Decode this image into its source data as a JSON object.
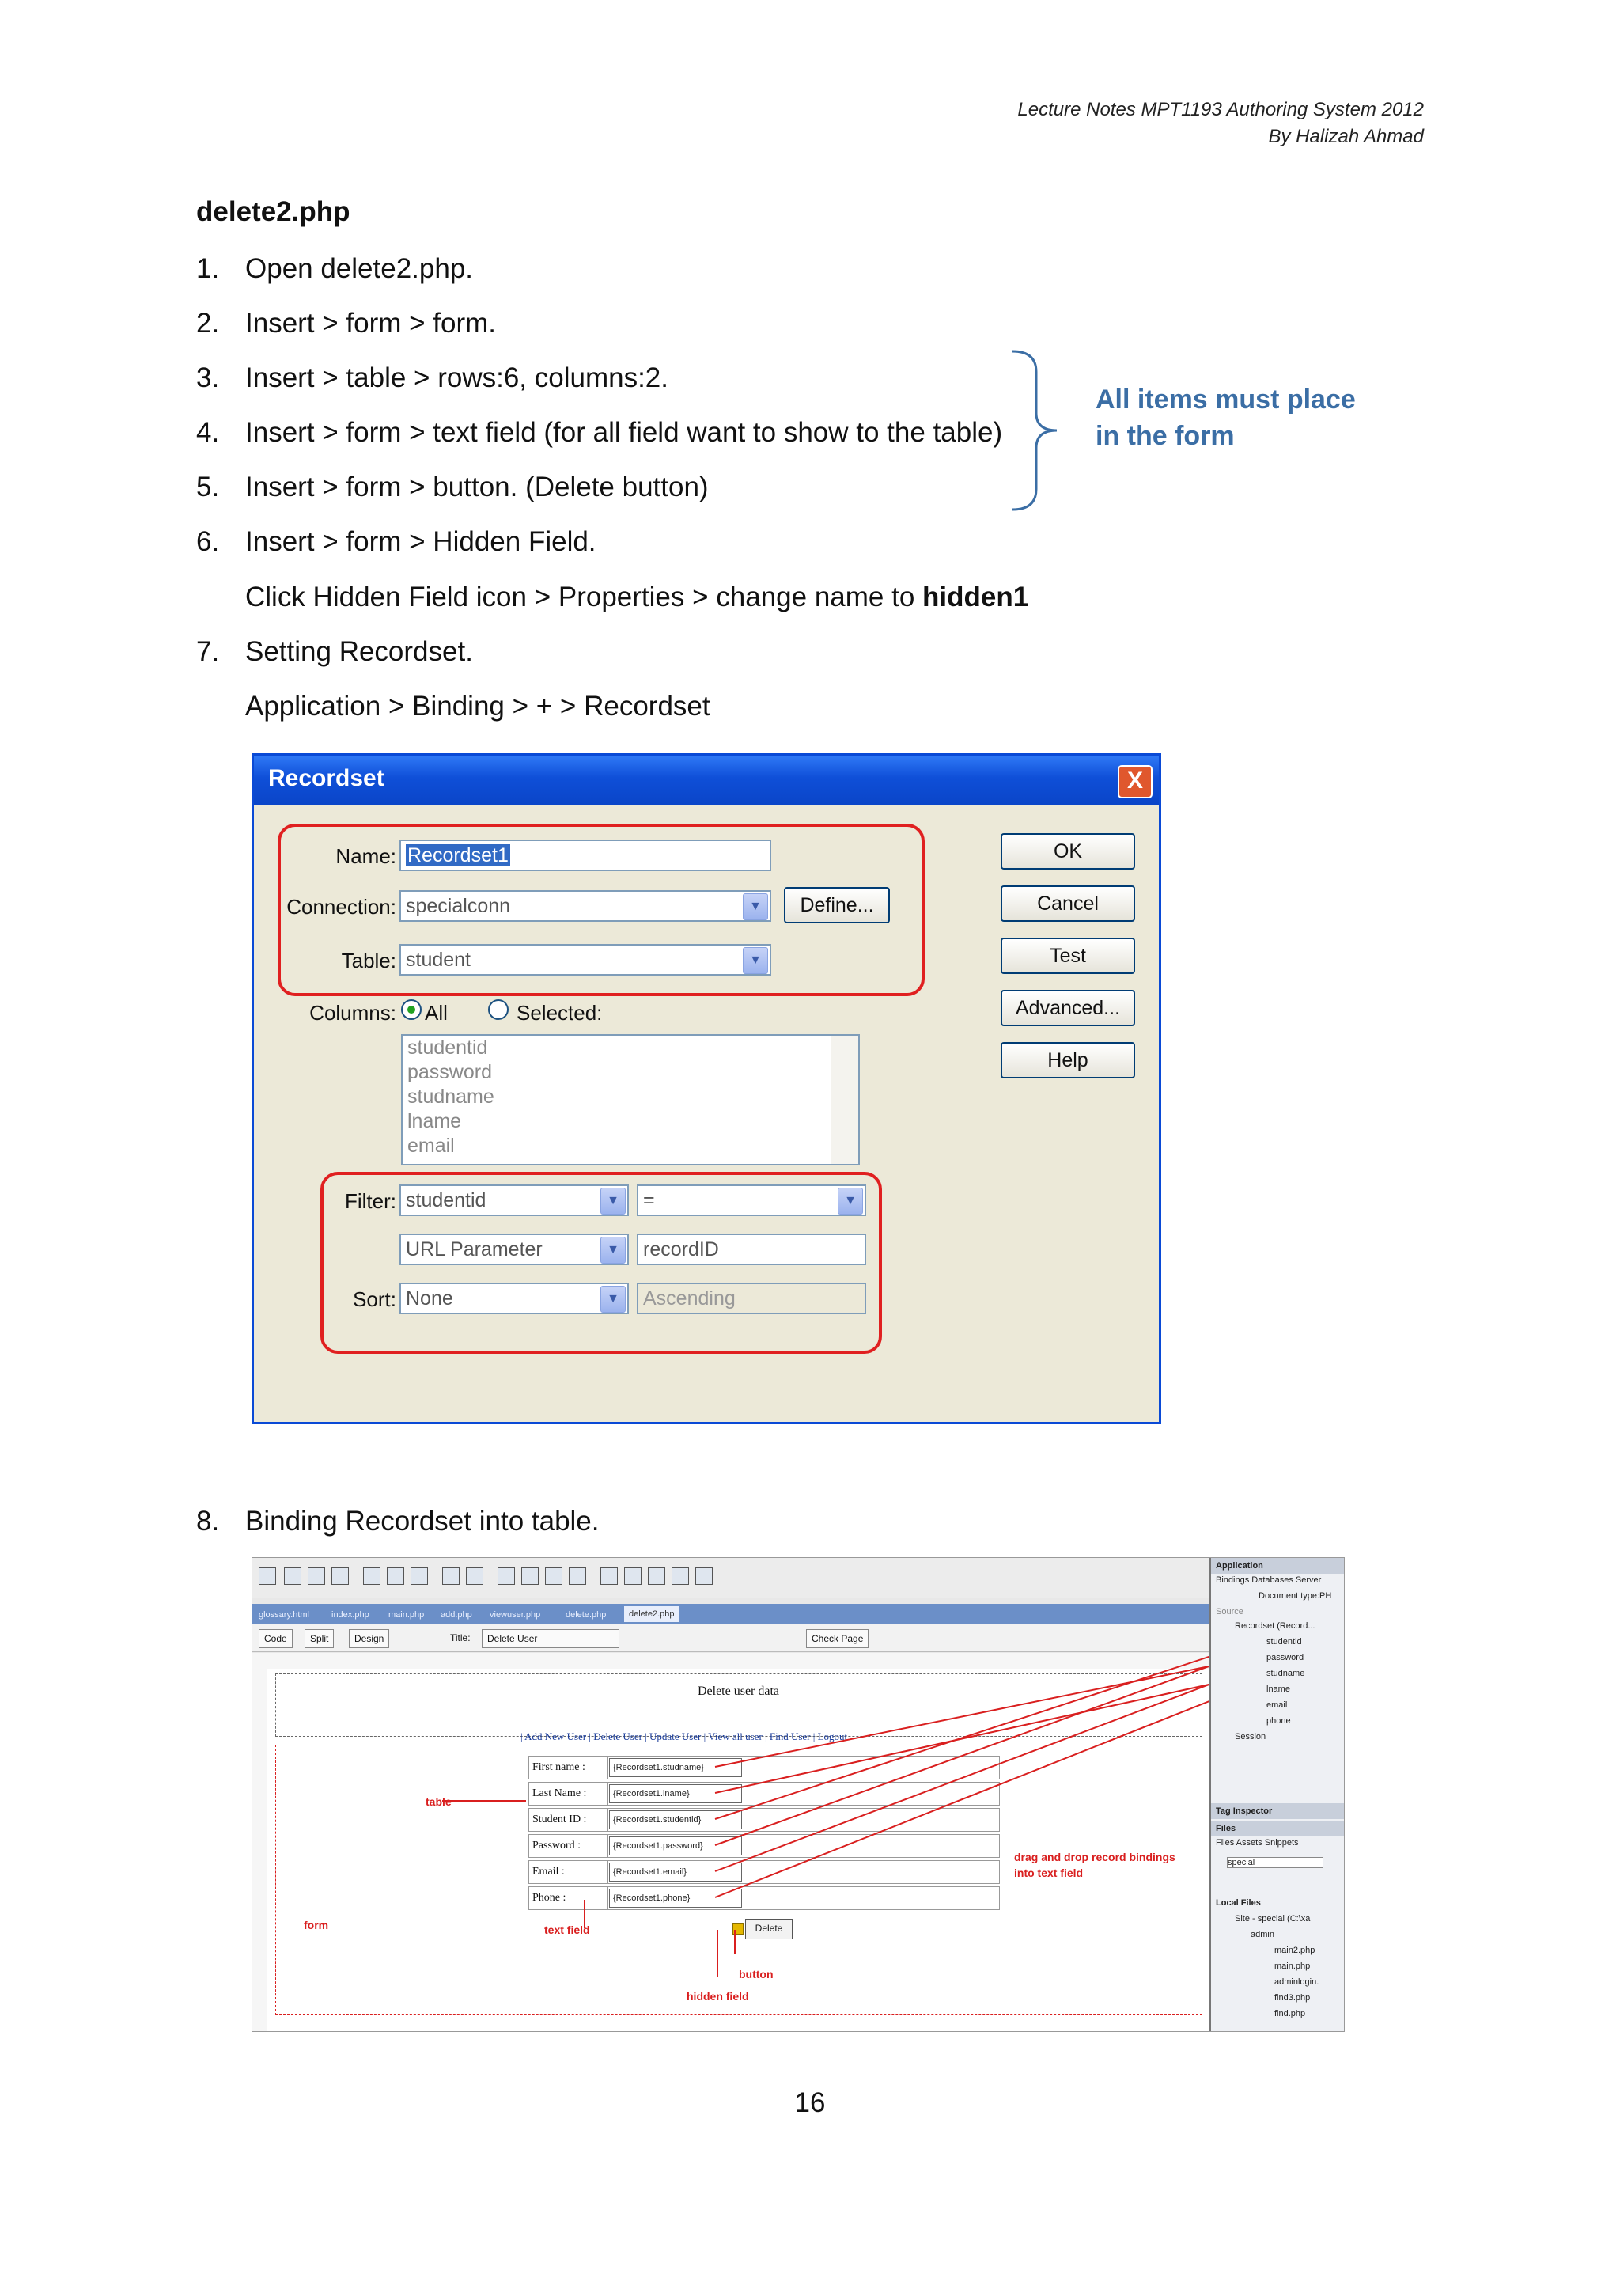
{
  "header": {
    "line1": "Lecture Notes  MPT1193 Authoring System 2012",
    "line2": "By Halizah Ahmad"
  },
  "title": "delete2.php",
  "steps": [
    {
      "num": "1.",
      "text": "Open delete2.php."
    },
    {
      "num": "2.",
      "text": "Insert > form > form."
    },
    {
      "num": "3.",
      "text": "Insert > table > rows:6, columns:2."
    },
    {
      "num": "4.",
      "text": "Insert > form > text field (for all field want to show to the table)"
    },
    {
      "num": "5.",
      "text": "Insert > form > button. (Delete button)"
    },
    {
      "num": "6.",
      "text": "Insert > form > Hidden Field."
    },
    {
      "num": "7.",
      "text": "Setting Recordset."
    },
    {
      "num": "8.",
      "text": "Binding Recordset into table."
    }
  ],
  "step6_sub": {
    "prefix": "Click Hidden Field icon > Properties > change name to ",
    "bold": "hidden1"
  },
  "step7_sub": "Application > Binding > + > Recordset",
  "callout": {
    "line1": "All items must place",
    "line2": "in the form"
  },
  "recordset_dialog": {
    "title": "Recordset",
    "close": "X",
    "name_label": "Name:",
    "name_value": "Recordset1",
    "connection_label": "Connection:",
    "connection_value": "specialconn",
    "define_button": "Define...",
    "table_label": "Table:",
    "table_value": "student",
    "columns_label": "Columns:",
    "columns_all": "All",
    "columns_selected": "Selected:",
    "column_items": [
      "studentid",
      "password",
      "studname",
      "lname",
      "email"
    ],
    "filter_label": "Filter:",
    "filter_column": "studentid",
    "filter_operator": "=",
    "filter_source": "URL Parameter",
    "filter_value": "recordID",
    "sort_label": "Sort:",
    "sort_value": "None",
    "sort_order": "Ascending",
    "buttons": [
      "OK",
      "Cancel",
      "Test",
      "Advanced...",
      "Help"
    ]
  },
  "dreamweaver": {
    "file_tabs": [
      "glossary.html",
      "index.php",
      "main.php",
      "add.php",
      "viewuser.php",
      "delete.php",
      "delete2.php"
    ],
    "view_buttons": [
      "Code",
      "Split",
      "Design"
    ],
    "title_label": "Title:",
    "title_value": "Delete User",
    "check_page": "Check Page",
    "page_heading": "Delete user data",
    "nav": "| Add New User | Delete User | Update User | View all user | Find User | Logout",
    "rows": [
      {
        "label": "First name :",
        "binding": "{Recordset1.studname}"
      },
      {
        "label": "Last Name :",
        "binding": "{Recordset1.lname}"
      },
      {
        "label": "Student ID :",
        "binding": "{Recordset1.studentid}"
      },
      {
        "label": "Password :",
        "binding": "{Recordset1.password}"
      },
      {
        "label": "Email :",
        "binding": "{Recordset1.email}"
      },
      {
        "label": "Phone :",
        "binding": "{Recordset1.phone}"
      }
    ],
    "delete_button": "Delete",
    "annotations": {
      "table": "table",
      "form": "form",
      "text_field": "text field",
      "button": "button",
      "hidden_field": "hidden field",
      "drag_line1": "drag and drop record bindings",
      "drag_line2": "into text field"
    },
    "panel": {
      "application": "Application",
      "tabs": "Bindings  Databases  Server",
      "doc_type": "Document type:PH",
      "source": "Source",
      "recordset": "Recordset (Record...",
      "fields": [
        "studentid",
        "password",
        "studname",
        "lname",
        "email",
        "phone"
      ],
      "session": "Session",
      "tag_inspector": "Tag Inspector",
      "files": "Files",
      "files_tabs": "Files  Assets  Snippets",
      "site_select": "special",
      "local_files": "Local Files",
      "site_root": "Site - special (C:\\xa",
      "admin": "admin",
      "admin_files": [
        "main2.php",
        "main.php",
        "adminlogin.",
        "find3.php",
        "find.php"
      ]
    }
  },
  "page_number": "16",
  "colors": {
    "callout": "#3b6ea5",
    "highlight_box": "#e02020",
    "xp_title": "#0f4fd8"
  }
}
